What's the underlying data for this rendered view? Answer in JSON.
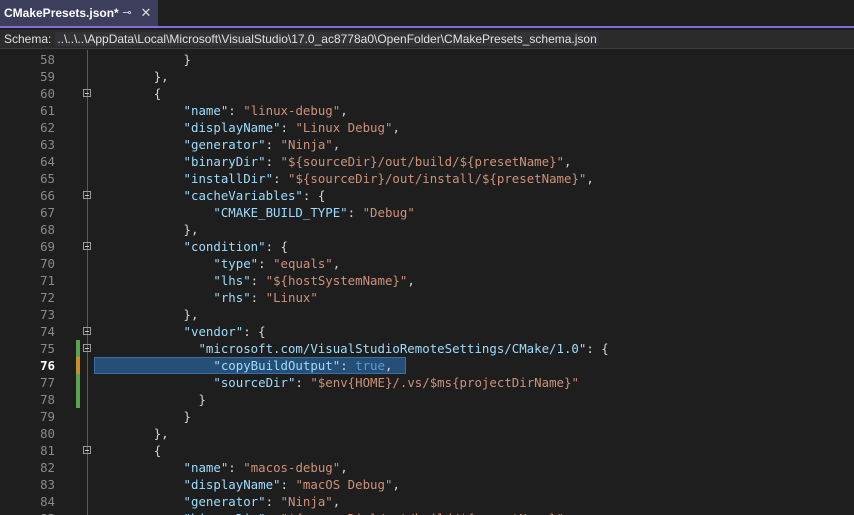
{
  "tab": {
    "title": "CMakePresets.json*",
    "pin_icon": "pin-icon",
    "close_icon": "close-icon"
  },
  "schema": {
    "label": "Schema:",
    "path": "..\\..\\..\\AppData\\Local\\Microsoft\\VisualStudio\\17.0_ac8778a0\\OpenFolder\\CMakePresets_schema.json"
  },
  "editor": {
    "current_line": 76,
    "lines": [
      {
        "n": 58,
        "text": "            }"
      },
      {
        "n": 59,
        "text": "        },"
      },
      {
        "n": 60,
        "text": "        {"
      },
      {
        "n": 61,
        "text": "            \"name\": \"linux-debug\","
      },
      {
        "n": 62,
        "text": "            \"displayName\": \"Linux Debug\","
      },
      {
        "n": 63,
        "text": "            \"generator\": \"Ninja\","
      },
      {
        "n": 64,
        "text": "            \"binaryDir\": \"${sourceDir}/out/build/${presetName}\","
      },
      {
        "n": 65,
        "text": "            \"installDir\": \"${sourceDir}/out/install/${presetName}\","
      },
      {
        "n": 66,
        "text": "            \"cacheVariables\": {"
      },
      {
        "n": 67,
        "text": "                \"CMAKE_BUILD_TYPE\": \"Debug\""
      },
      {
        "n": 68,
        "text": "            },"
      },
      {
        "n": 69,
        "text": "            \"condition\": {"
      },
      {
        "n": 70,
        "text": "                \"type\": \"equals\","
      },
      {
        "n": 71,
        "text": "                \"lhs\": \"${hostSystemName}\","
      },
      {
        "n": 72,
        "text": "                \"rhs\": \"Linux\""
      },
      {
        "n": 73,
        "text": "            },"
      },
      {
        "n": 74,
        "text": "            \"vendor\": {"
      },
      {
        "n": 75,
        "text": "              \"microsoft.com/VisualStudioRemoteSettings/CMake/1.0\": {"
      },
      {
        "n": 76,
        "text": "                \"copyBuildOutput\": true,"
      },
      {
        "n": 77,
        "text": "                \"sourceDir\": \"$env{HOME}/.vs/$ms{projectDirName}\""
      },
      {
        "n": 78,
        "text": "              }"
      },
      {
        "n": 79,
        "text": "            }"
      },
      {
        "n": 80,
        "text": "        },"
      },
      {
        "n": 81,
        "text": "        {"
      },
      {
        "n": 82,
        "text": "            \"name\": \"macos-debug\","
      },
      {
        "n": 83,
        "text": "            \"displayName\": \"macOS Debug\","
      },
      {
        "n": 84,
        "text": "            \"generator\": \"Ninja\","
      },
      {
        "n": 85,
        "text": "            \"binaryDir\": \"${sourceDir}/out/build/${presetName}\","
      }
    ],
    "fold_lines": [
      60,
      66,
      69,
      74,
      75,
      81
    ],
    "changed_lines": [
      75,
      76,
      77,
      78
    ],
    "colors": {
      "key": "#9cdcfe",
      "string": "#ce9178",
      "boolean": "#569cd6",
      "punctuation": "#d4d4d4",
      "selection": "#264f78",
      "change_bar": "#57a64a",
      "tab_accent": "#7c6fd6"
    }
  }
}
